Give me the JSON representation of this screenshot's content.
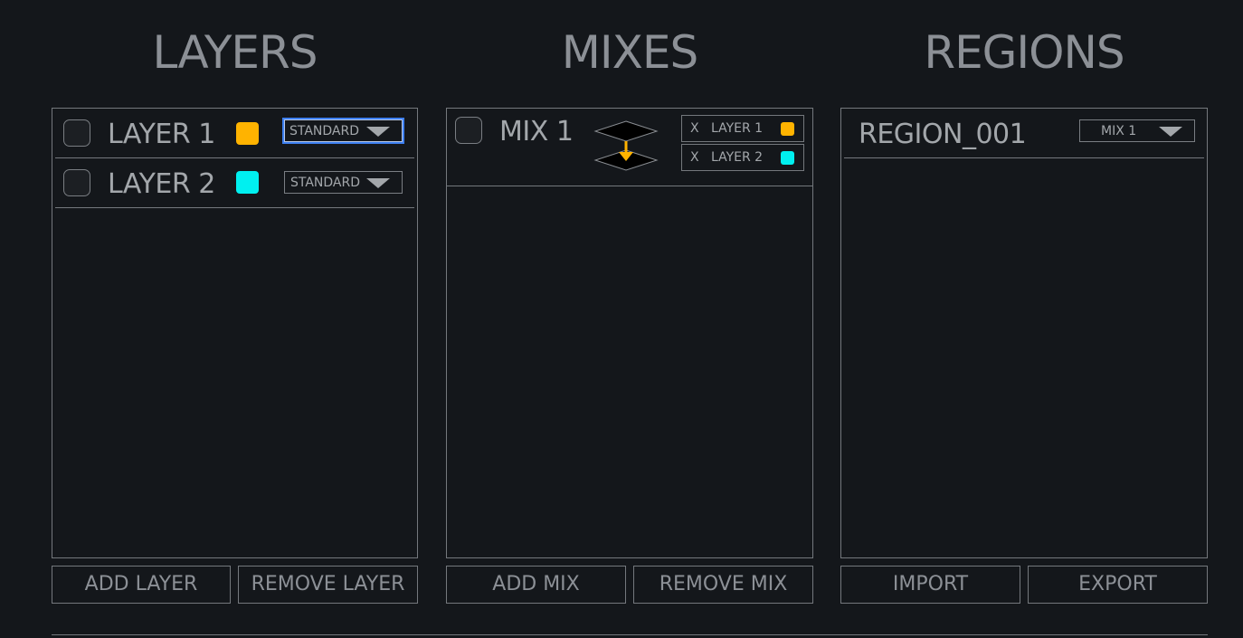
{
  "layers": {
    "title": "LAYERS",
    "items": [
      {
        "label": "LAYER 1",
        "color": "#ffb300",
        "mode": "STANDARD",
        "focused": true
      },
      {
        "label": "LAYER 2",
        "color": "#00f0f0",
        "mode": "STANDARD",
        "focused": false
      }
    ],
    "add_label": "ADD LAYER",
    "remove_label": "REMOVE LAYER"
  },
  "mixes": {
    "title": "MIXES",
    "items": [
      {
        "label": "MIX 1",
        "icon": "layer-merge-icon",
        "layers": [
          {
            "remove": "X",
            "label": "LAYER 1",
            "color": "#ffb300"
          },
          {
            "remove": "X",
            "label": "LAYER 2",
            "color": "#00f0f0"
          }
        ]
      }
    ],
    "add_label": "ADD MIX",
    "remove_label": "REMOVE MIX"
  },
  "regions": {
    "title": "REGIONS",
    "items": [
      {
        "label": "REGION_001",
        "mix": "MIX 1"
      }
    ],
    "import_label": "IMPORT",
    "export_label": "EXPORT"
  },
  "colors": {
    "background": "#14171b",
    "border": "#74787d",
    "accent_orange": "#ffb300",
    "accent_cyan": "#00f0f0",
    "focus": "#3d7ff0"
  }
}
